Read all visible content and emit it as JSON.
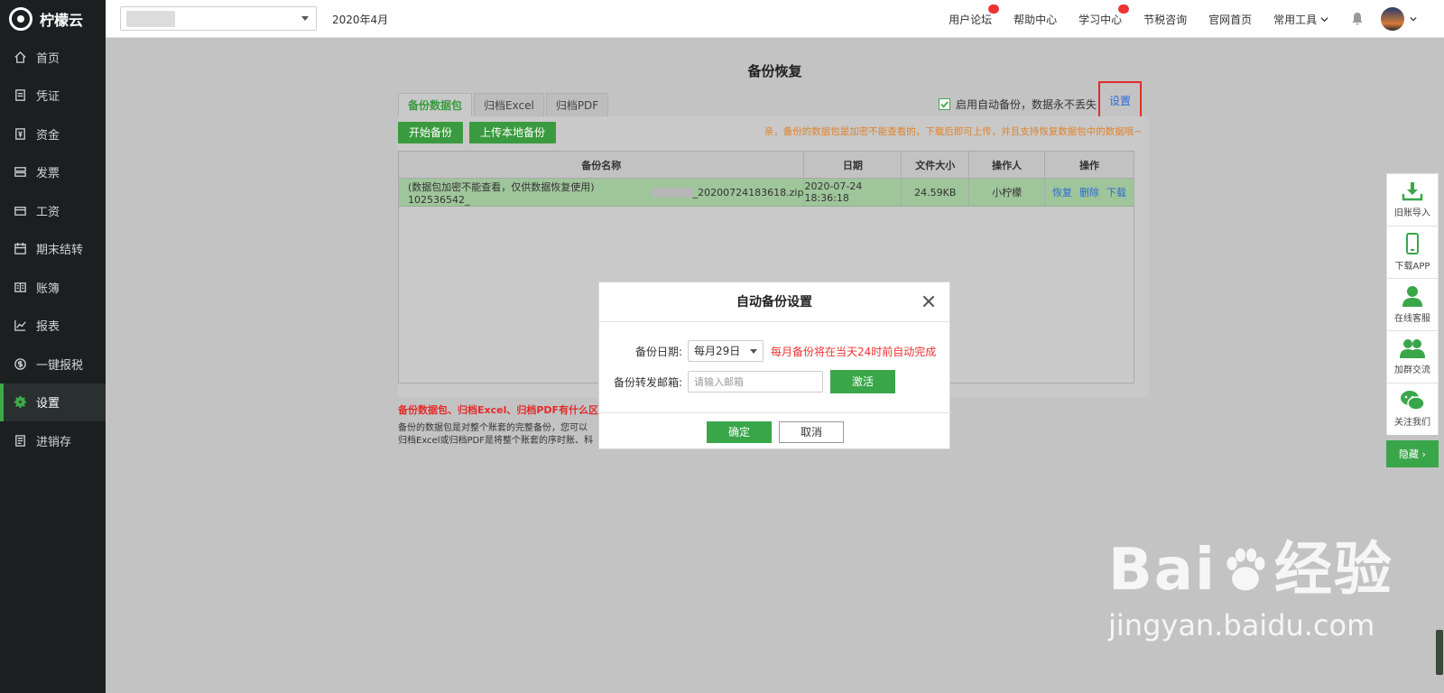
{
  "app": {
    "name": "柠檬云"
  },
  "sidebar": {
    "items": [
      {
        "label": "首页",
        "icon": "home-icon"
      },
      {
        "label": "凭证",
        "icon": "voucher-icon"
      },
      {
        "label": "资金",
        "icon": "fund-icon"
      },
      {
        "label": "发票",
        "icon": "invoice-icon"
      },
      {
        "label": "工资",
        "icon": "salary-icon"
      },
      {
        "label": "期末结转",
        "icon": "calendar-icon"
      },
      {
        "label": "账簿",
        "icon": "book-icon"
      },
      {
        "label": "报表",
        "icon": "chart-icon"
      },
      {
        "label": "一键报税",
        "icon": "tax-icon"
      },
      {
        "label": "设置",
        "icon": "gear-icon",
        "active": true
      },
      {
        "label": "进销存",
        "icon": "inventory-icon"
      }
    ]
  },
  "topbar": {
    "period": "2020年4月",
    "links": [
      "用户论坛",
      "帮助中心",
      "学习中心",
      "节税咨询",
      "官网首页",
      "常用工具"
    ]
  },
  "page": {
    "title": "备份恢复"
  },
  "tabs": [
    {
      "label": "备份数据包",
      "active": true
    },
    {
      "label": "归档Excel"
    },
    {
      "label": "归档PDF"
    }
  ],
  "auto_backup": {
    "label": "启用自动备份，数据永不丢失",
    "checked": true,
    "settings_link": "设置"
  },
  "toolbar": {
    "start_backup": "开始备份",
    "upload_local": "上传本地备份"
  },
  "notice": "亲，备份的数据包是加密不能查看的，下载后即可上传，并且支持恢复数据包中的数据哦~",
  "table": {
    "headers": [
      "备份名称",
      "日期",
      "文件大小",
      "操作人",
      "操作"
    ],
    "rows": [
      {
        "name_prefix": "(数据包加密不能查看，仅供数据恢复使用) 102536542_",
        "name_suffix": "_20200724183618.zip",
        "date": "2020-07-24 18:36:18",
        "size": "24.59KB",
        "operator": "小柠檬",
        "actions": [
          "恢复",
          "删除",
          "下载"
        ]
      }
    ]
  },
  "faq": {
    "title": "备份数据包、归档Excel、归档PDF有什么区别?",
    "line1": "备份的数据包是对整个账套的完整备份，您可以",
    "line2": "归档Excel或归档PDF是将整个账套的序时账、科"
  },
  "modal": {
    "title": "自动备份设置",
    "date_label": "备份日期:",
    "date_value": "每月29日",
    "date_hint": "每月备份将在当天24时前自动完成",
    "email_label": "备份转发邮箱:",
    "email_placeholder": "请输入邮箱",
    "activate": "激活",
    "ok": "确定",
    "cancel": "取消"
  },
  "float_bar": {
    "items": [
      {
        "label": "旧账导入",
        "icon": "download-icon"
      },
      {
        "label": "下载APP",
        "icon": "phone-icon"
      },
      {
        "label": "在线客服",
        "icon": "person-icon"
      },
      {
        "label": "加群交流",
        "icon": "group-icon"
      },
      {
        "label": "关注我们",
        "icon": "wechat-icon"
      }
    ],
    "hide": "隐藏 ›"
  },
  "watermark": {
    "brand": "Bai",
    "brand_end": "经验",
    "url": "jingyan.baidu.com"
  },
  "colors": {
    "accent": "#3daa48",
    "sidebar_bg": "#1b1f20",
    "link": "#2d6ad6",
    "warning": "#e0832b",
    "error": "#e32c2c"
  }
}
